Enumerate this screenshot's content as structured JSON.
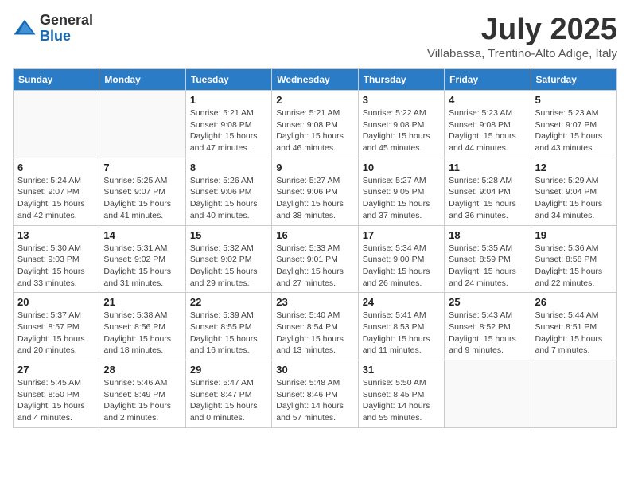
{
  "logo": {
    "general": "General",
    "blue": "Blue"
  },
  "title": "July 2025",
  "location": "Villabassa, Trentino-Alto Adige, Italy",
  "weekdays": [
    "Sunday",
    "Monday",
    "Tuesday",
    "Wednesday",
    "Thursday",
    "Friday",
    "Saturday"
  ],
  "weeks": [
    [
      {
        "day": "",
        "info": ""
      },
      {
        "day": "",
        "info": ""
      },
      {
        "day": "1",
        "info": "Sunrise: 5:21 AM\nSunset: 9:08 PM\nDaylight: 15 hours\nand 47 minutes."
      },
      {
        "day": "2",
        "info": "Sunrise: 5:21 AM\nSunset: 9:08 PM\nDaylight: 15 hours\nand 46 minutes."
      },
      {
        "day": "3",
        "info": "Sunrise: 5:22 AM\nSunset: 9:08 PM\nDaylight: 15 hours\nand 45 minutes."
      },
      {
        "day": "4",
        "info": "Sunrise: 5:23 AM\nSunset: 9:08 PM\nDaylight: 15 hours\nand 44 minutes."
      },
      {
        "day": "5",
        "info": "Sunrise: 5:23 AM\nSunset: 9:07 PM\nDaylight: 15 hours\nand 43 minutes."
      }
    ],
    [
      {
        "day": "6",
        "info": "Sunrise: 5:24 AM\nSunset: 9:07 PM\nDaylight: 15 hours\nand 42 minutes."
      },
      {
        "day": "7",
        "info": "Sunrise: 5:25 AM\nSunset: 9:07 PM\nDaylight: 15 hours\nand 41 minutes."
      },
      {
        "day": "8",
        "info": "Sunrise: 5:26 AM\nSunset: 9:06 PM\nDaylight: 15 hours\nand 40 minutes."
      },
      {
        "day": "9",
        "info": "Sunrise: 5:27 AM\nSunset: 9:06 PM\nDaylight: 15 hours\nand 38 minutes."
      },
      {
        "day": "10",
        "info": "Sunrise: 5:27 AM\nSunset: 9:05 PM\nDaylight: 15 hours\nand 37 minutes."
      },
      {
        "day": "11",
        "info": "Sunrise: 5:28 AM\nSunset: 9:04 PM\nDaylight: 15 hours\nand 36 minutes."
      },
      {
        "day": "12",
        "info": "Sunrise: 5:29 AM\nSunset: 9:04 PM\nDaylight: 15 hours\nand 34 minutes."
      }
    ],
    [
      {
        "day": "13",
        "info": "Sunrise: 5:30 AM\nSunset: 9:03 PM\nDaylight: 15 hours\nand 33 minutes."
      },
      {
        "day": "14",
        "info": "Sunrise: 5:31 AM\nSunset: 9:02 PM\nDaylight: 15 hours\nand 31 minutes."
      },
      {
        "day": "15",
        "info": "Sunrise: 5:32 AM\nSunset: 9:02 PM\nDaylight: 15 hours\nand 29 minutes."
      },
      {
        "day": "16",
        "info": "Sunrise: 5:33 AM\nSunset: 9:01 PM\nDaylight: 15 hours\nand 27 minutes."
      },
      {
        "day": "17",
        "info": "Sunrise: 5:34 AM\nSunset: 9:00 PM\nDaylight: 15 hours\nand 26 minutes."
      },
      {
        "day": "18",
        "info": "Sunrise: 5:35 AM\nSunset: 8:59 PM\nDaylight: 15 hours\nand 24 minutes."
      },
      {
        "day": "19",
        "info": "Sunrise: 5:36 AM\nSunset: 8:58 PM\nDaylight: 15 hours\nand 22 minutes."
      }
    ],
    [
      {
        "day": "20",
        "info": "Sunrise: 5:37 AM\nSunset: 8:57 PM\nDaylight: 15 hours\nand 20 minutes."
      },
      {
        "day": "21",
        "info": "Sunrise: 5:38 AM\nSunset: 8:56 PM\nDaylight: 15 hours\nand 18 minutes."
      },
      {
        "day": "22",
        "info": "Sunrise: 5:39 AM\nSunset: 8:55 PM\nDaylight: 15 hours\nand 16 minutes."
      },
      {
        "day": "23",
        "info": "Sunrise: 5:40 AM\nSunset: 8:54 PM\nDaylight: 15 hours\nand 13 minutes."
      },
      {
        "day": "24",
        "info": "Sunrise: 5:41 AM\nSunset: 8:53 PM\nDaylight: 15 hours\nand 11 minutes."
      },
      {
        "day": "25",
        "info": "Sunrise: 5:43 AM\nSunset: 8:52 PM\nDaylight: 15 hours\nand 9 minutes."
      },
      {
        "day": "26",
        "info": "Sunrise: 5:44 AM\nSunset: 8:51 PM\nDaylight: 15 hours\nand 7 minutes."
      }
    ],
    [
      {
        "day": "27",
        "info": "Sunrise: 5:45 AM\nSunset: 8:50 PM\nDaylight: 15 hours\nand 4 minutes."
      },
      {
        "day": "28",
        "info": "Sunrise: 5:46 AM\nSunset: 8:49 PM\nDaylight: 15 hours\nand 2 minutes."
      },
      {
        "day": "29",
        "info": "Sunrise: 5:47 AM\nSunset: 8:47 PM\nDaylight: 15 hours\nand 0 minutes."
      },
      {
        "day": "30",
        "info": "Sunrise: 5:48 AM\nSunset: 8:46 PM\nDaylight: 14 hours\nand 57 minutes."
      },
      {
        "day": "31",
        "info": "Sunrise: 5:50 AM\nSunset: 8:45 PM\nDaylight: 14 hours\nand 55 minutes."
      },
      {
        "day": "",
        "info": ""
      },
      {
        "day": "",
        "info": ""
      }
    ]
  ]
}
